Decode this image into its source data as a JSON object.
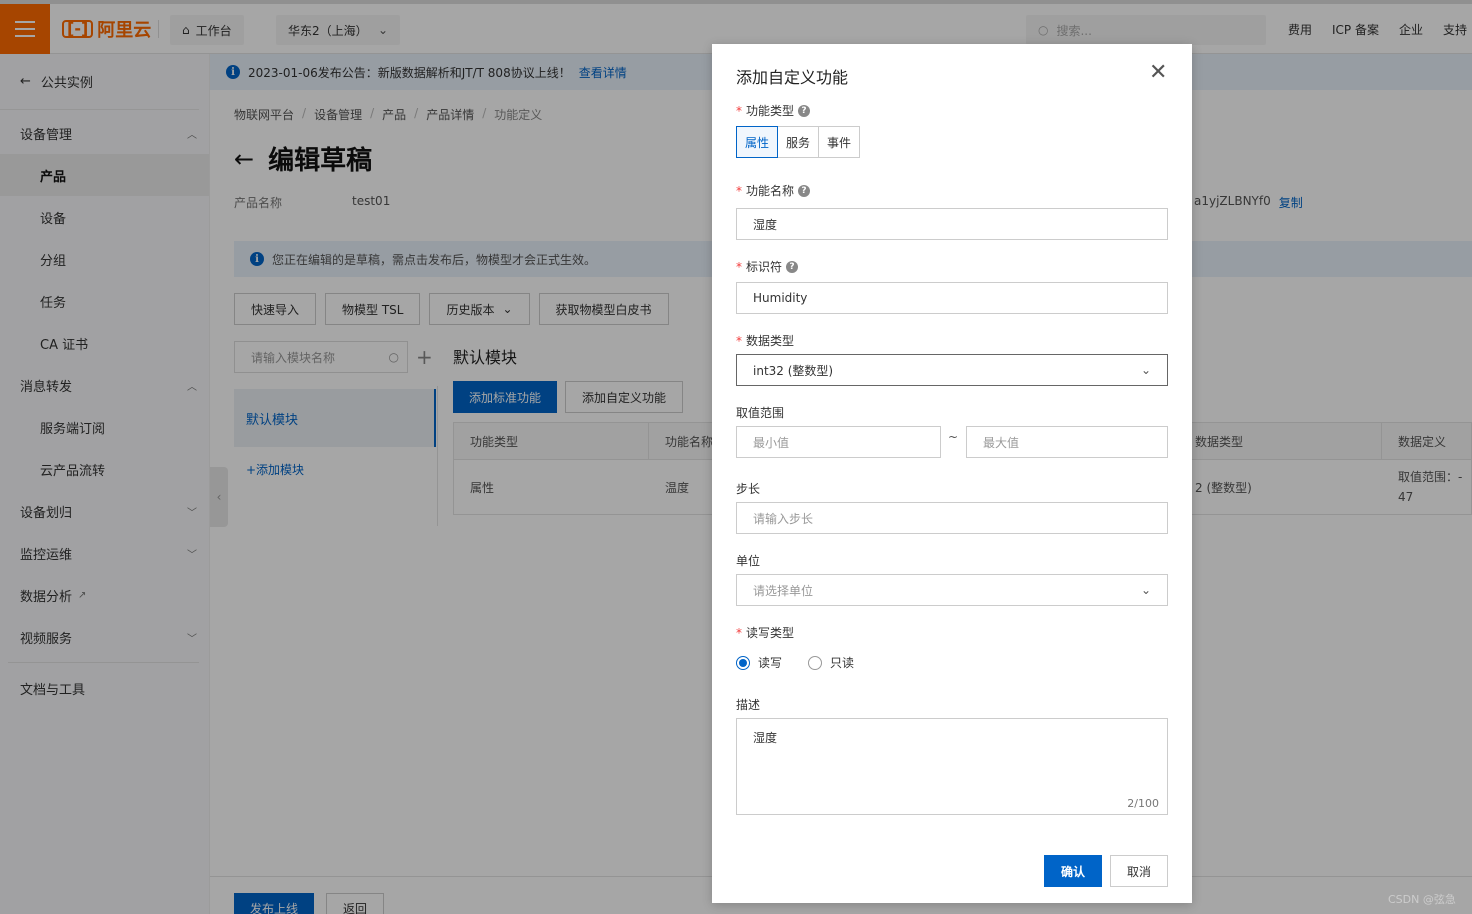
{
  "topbar": {
    "logo_text": "阿里云",
    "workbench": "工作台",
    "region": "华东2（上海）",
    "search_placeholder": "搜索...",
    "links": [
      "费用",
      "ICP 备案",
      "企业",
      "支持"
    ]
  },
  "sidebar": {
    "back": "公共实例",
    "groups": [
      {
        "label": "设备管理",
        "expanded": true,
        "items": [
          "产品",
          "设备",
          "分组",
          "任务",
          "CA 证书"
        ]
      },
      {
        "label": "消息转发",
        "expanded": true,
        "items": [
          "服务端订阅",
          "云产品流转"
        ]
      },
      {
        "label": "设备划归",
        "expanded": false,
        "items": []
      },
      {
        "label": "监控运维",
        "expanded": false,
        "items": []
      },
      {
        "label": "数据分析",
        "external": true,
        "items": []
      },
      {
        "label": "视频服务",
        "expanded": false,
        "items": []
      }
    ],
    "bottom": "文档与工具",
    "active_item": "产品"
  },
  "notice": {
    "text": "2023-01-06发布公告：新版数据解析和JT/T 808协议上线！",
    "link": "查看详情"
  },
  "breadcrumb": [
    "物联网平台",
    "设备管理",
    "产品",
    "产品详情",
    "功能定义"
  ],
  "page": {
    "title": "编辑草稿",
    "product_name_label": "产品名称",
    "product_name_value": "test01",
    "product_key_value": "a1yjZLBNYf0",
    "copy_label": "复制",
    "draft_notice": "您正在编辑的是草稿，需点击发布后，物模型才会正式生效。"
  },
  "toolbar": {
    "quick_import": "快速导入",
    "tsl": "物模型 TSL",
    "history": "历史版本",
    "whitepaper": "获取物模型白皮书"
  },
  "modules": {
    "search_placeholder": "请输入模块名称",
    "default_module": "默认模块",
    "add_module": "+添加模块",
    "section_title": "默认模块",
    "add_standard": "添加标准功能",
    "add_custom": "添加自定义功能"
  },
  "table": {
    "columns": [
      "功能类型",
      "功能名称",
      "数据类型",
      "数据定义"
    ],
    "rows": [
      {
        "type": "属性",
        "name": "温度",
        "datatype_fragment": "2 (整数型)",
        "definition_line1": "取值范围：-",
        "definition_line2": "47"
      }
    ]
  },
  "footer": {
    "publish": "发布上线",
    "back": "返回"
  },
  "modal": {
    "title": "添加自定义功能",
    "func_type_label": "功能类型",
    "func_type_options": [
      "属性",
      "服务",
      "事件"
    ],
    "func_type_selected": "属性",
    "func_name_label": "功能名称",
    "func_name_value": "湿度",
    "identifier_label": "标识符",
    "identifier_value": "Humidity",
    "datatype_label": "数据类型",
    "datatype_value": "int32 (整数型)",
    "range_label": "取值范围",
    "range_min_placeholder": "最小值",
    "range_sep": "~",
    "range_max_placeholder": "最大值",
    "step_label": "步长",
    "step_placeholder": "请输入步长",
    "unit_label": "单位",
    "unit_placeholder": "请选择单位",
    "rw_label": "读写类型",
    "rw_options": [
      "读写",
      "只读"
    ],
    "rw_selected": "读写",
    "desc_label": "描述",
    "desc_value": "湿度",
    "desc_counter": "2/100",
    "ok": "确认",
    "cancel": "取消"
  },
  "watermark": "CSDN @弦急",
  "colors": {
    "brand": "#ff6a00",
    "primary": "#0064c8",
    "required": "#f23c3c"
  }
}
